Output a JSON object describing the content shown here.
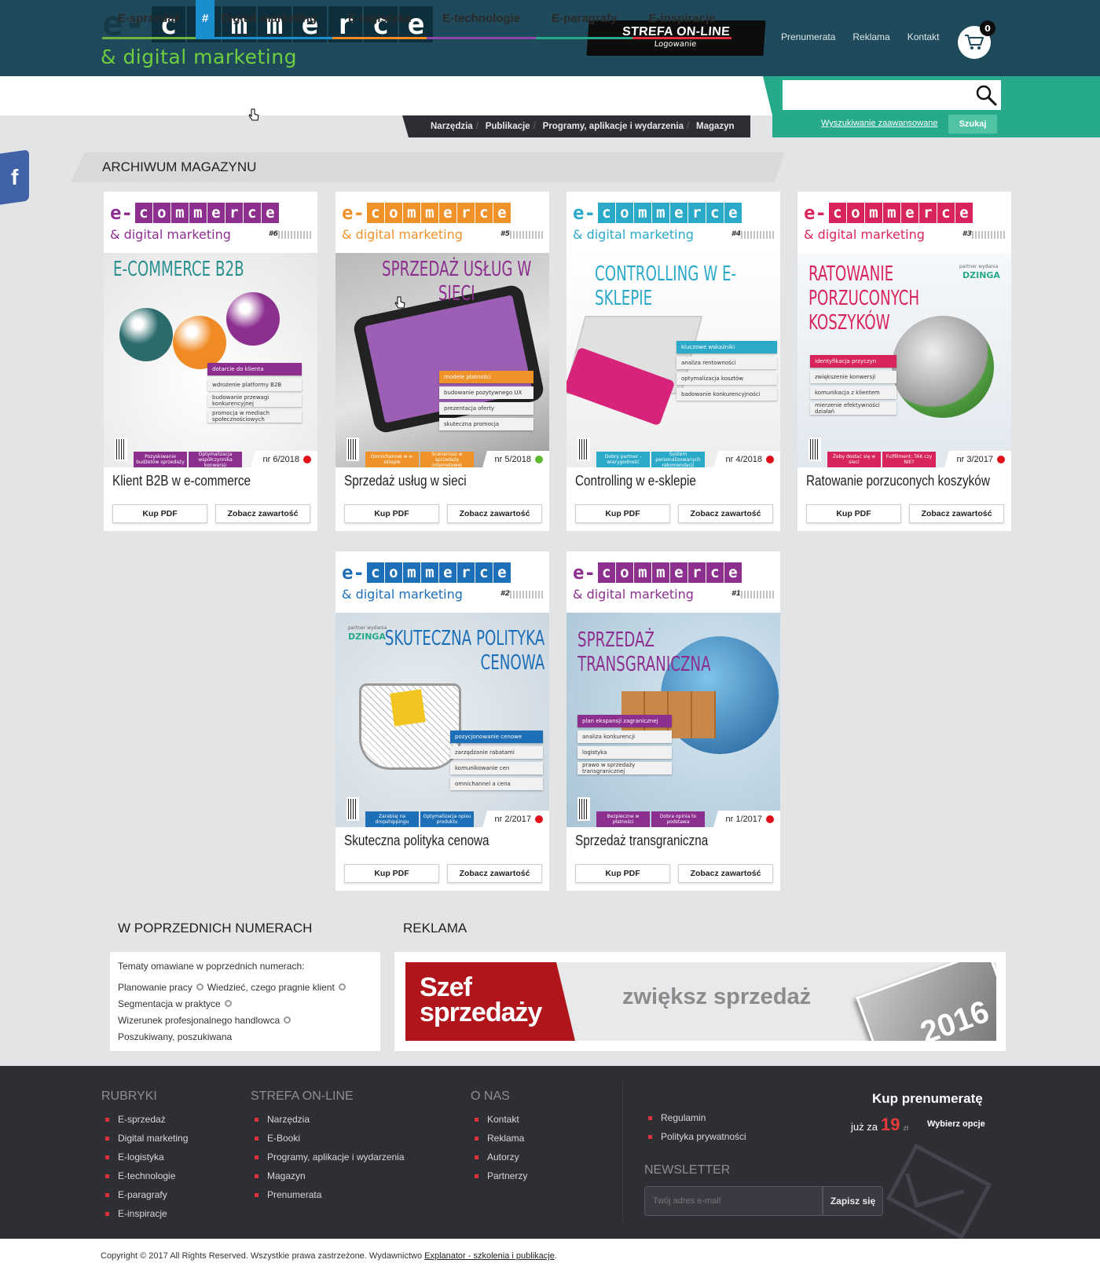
{
  "header": {
    "logo_prefix": "e-",
    "logo_letters": [
      "c",
      "o",
      "m",
      "m",
      "e",
      "r",
      "c",
      "e"
    ],
    "logo_sub": "& digital marketing",
    "strefa_title": "STREFA ON-LINE",
    "strefa_sub": "Logowanie",
    "links": [
      "Prenumerata",
      "Reklama",
      "Kontakt"
    ],
    "cart_count": "0"
  },
  "nav": {
    "items": [
      {
        "label": "E-sprzedaż",
        "color": "#6cb33f"
      },
      {
        "label": "Digital marketing",
        "color": "#1a8fd0",
        "prefix": "#"
      },
      {
        "label": "E-logistyka",
        "color": "#f28c28"
      },
      {
        "label": "E-technologie",
        "color": "#8e44ad"
      },
      {
        "label": "E-paragrafy",
        "color": "#27a98c"
      },
      {
        "label": "E-inspiracje",
        "color": "#e0303b"
      }
    ],
    "subnav": [
      "Narzędzia",
      "Publikacje",
      "Programy, aplikacje i wydarzenia",
      "Magazyn"
    ],
    "search_placeholder": "",
    "advanced_search": "Wyszukiwanie zaawansowane",
    "search_button": "Szukaj"
  },
  "social": {
    "facebook": "f"
  },
  "archive": {
    "title": "ARCHIWUM MAGAZYNU",
    "buy_label": "Kup PDF",
    "view_label": "Zobacz zawartość",
    "issues": [
      {
        "issue": "nr 6/2018",
        "status": "#e0101b",
        "title": "Klient B2B w e-commerce",
        "accent": "#8c2f8f",
        "cover_no": "#6",
        "cover_title": "E-COMMERCE B2B",
        "title_color": "#2b8f8f",
        "bullets": [
          "dotarcie do klienta",
          "wdrożenie platformy B2B",
          "budowanie przewagi konkurencyjnej",
          "promocja w mediach społecznościowych"
        ],
        "strip": [
          "Pozyskiwanie budżetów sprzedaży",
          "Optymalizacja współczynnika konwersji"
        ],
        "theme": "b2b"
      },
      {
        "issue": "nr 5/2018",
        "status": "#5cb82f",
        "title": "Sprzedaż usług w sieci",
        "accent": "#f0922a",
        "cover_no": "#5",
        "cover_title": "SPRZEDAŻ USŁUG W SIECI",
        "title_color": "#8c2f8f",
        "bullets": [
          "modele płatności",
          "budowanie pozytywnego UX",
          "prezentacja oferty",
          "skuteczna promocja"
        ],
        "strip": [
          "Omnichannel w e-sklepie",
          "Scenariusz w sprzedaży internetowej"
        ],
        "theme": "uslugi"
      },
      {
        "issue": "nr 4/2018",
        "status": "#e0101b",
        "title": "Controlling w e-sklepie",
        "accent": "#2aa9c9",
        "cover_no": "#4",
        "cover_title": "CONTROLLING W E-SKLEPIE",
        "title_color": "#2aa9c9",
        "bullets": [
          "kluczowe wskaźniki",
          "analiza rentowności",
          "optymalizacja kosztów",
          "badowanie konkurencyjności"
        ],
        "strip": [
          "Dobry partner - wiarygodność",
          "System personalizowanych rekomendacji"
        ],
        "theme": "controlling"
      },
      {
        "issue": "nr 3/2017",
        "status": "#e0101b",
        "title": "Ratowanie porzuconych koszyków",
        "accent": "#d8245c",
        "cover_no": "#3",
        "cover_title": "RATOWANIE PORZUCONYCH KOSZYKÓW",
        "title_color": "#d8245c",
        "bullets": [
          "identyfikacja przyczyn",
          "zwiększenie konwersji",
          "komunikacja z klientem",
          "mierzenie efektywności działań"
        ],
        "strip": [
          "Żeby dostać się w sieci",
          "Fulfillment: TAK czy NIE?"
        ],
        "theme": "exit",
        "partner": "partner wydania",
        "partner_name": "DZINGA"
      },
      {
        "issue": "nr 2/2017",
        "status": "#e0101b",
        "title": "Skuteczna polityka cenowa",
        "accent": "#1d6fb8",
        "cover_no": "#2",
        "cover_title": "SKUTECZNA POLITYKA CENOWA",
        "title_color": "#1d6fb8",
        "bullets": [
          "pozycjonowanie cenowe",
          "zarządzanie rabatami",
          "komunikowanie cen",
          "omnichannel a cena"
        ],
        "strip": [
          "Zarabiaj na dropshippingu",
          "Optymalizacja opisu produktu"
        ],
        "theme": "cenowa",
        "partner": "partner wydania",
        "partner_name": "DZINGA"
      },
      {
        "issue": "nr 1/2017",
        "status": "#e0101b",
        "title": "Sprzedaż transgraniczna",
        "accent": "#8c2f8f",
        "cover_no": "#1",
        "cover_title": "SPRZEDAŻ TRANSGRANICZNA",
        "title_color": "#8c2f8f",
        "bullets": [
          "plan ekspansji zagranicznej",
          "analiza konkurencji",
          "logistyka",
          "prawo w sprzedaży transgranicznej"
        ],
        "strip": [
          "Bezpieczne w płatności",
          "Dobra opinia to podstawa"
        ],
        "theme": "trans"
      }
    ]
  },
  "previous": {
    "title": "W POPRZEDNICH NUMERACH",
    "intro": "Tematy omawiane w poprzednich numerach:",
    "tags": [
      "Planowanie pracy",
      "Wiedzieć, czego pragnie klient",
      "Segmentacja w praktyce",
      "Wizerunek profesjonalnego handlowca",
      "Poszukiwany, poszukiwana"
    ]
  },
  "ad": {
    "title": "REKLAMA",
    "brand": "Szef sprzedaży",
    "brand_l1": "Szef",
    "brand_l2": "sprzedaży",
    "slogan": "zwiększ sprzedaż",
    "mag_year": "2016"
  },
  "footer": {
    "rubryki": {
      "title": "RUBRYKI",
      "items": [
        "E-sprzedaż",
        "Digital marketing",
        "E-logistyka",
        "E-technologie",
        "E-paragrafy",
        "E-inspiracje"
      ]
    },
    "strefa": {
      "title": "STREFA ON-LINE",
      "items": [
        "Narzędzia",
        "E-Booki",
        "Programy, aplikacje i wydarzenia",
        "Magazyn",
        "Prenumerata"
      ]
    },
    "onas": {
      "title": "O NAS",
      "items": [
        "Kontakt",
        "Reklama",
        "Autorzy",
        "Partnerzy"
      ]
    },
    "legal": {
      "items": [
        "Regulamin",
        "Polityka prywatności"
      ]
    },
    "subscribe_title": "Kup prenumeratę",
    "price_prefix": "już za",
    "price": "19",
    "currency": "zł",
    "choose": "Wybierz opcje",
    "newsletter_title": "NEWSLETTER",
    "newsletter_placeholder": "Twój adres e-mail",
    "newsletter_button": "Zapisz się"
  },
  "copyright": {
    "text": "Copyright © 2017 All Rights Reserved. Wszystkie prawa zastrzeżone. Wydawnictwo ",
    "link": "Explanator - szkolenia i publikacje",
    "suffix": "."
  }
}
